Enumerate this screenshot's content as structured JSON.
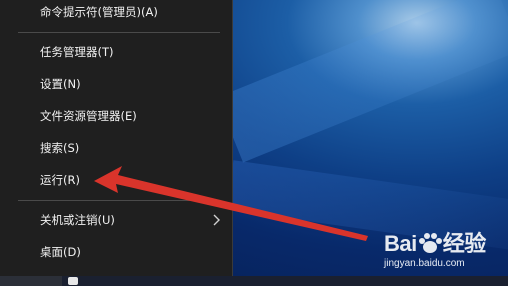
{
  "menu": {
    "items": [
      {
        "label": "命令提示符(管理员)(A)"
      },
      {
        "label": "任务管理器(T)"
      },
      {
        "label": "设置(N)"
      },
      {
        "label": "文件资源管理器(E)"
      },
      {
        "label": "搜索(S)"
      },
      {
        "label": "运行(R)"
      },
      {
        "label": "关机或注销(U)"
      },
      {
        "label": "桌面(D)"
      }
    ]
  },
  "watermark": {
    "brand_pre": "Bai",
    "brand_post": "经验",
    "url": "jingyan.baidu.com"
  },
  "colors": {
    "menu_bg": "#1f1f1f",
    "arrow": "#d9342b",
    "text": "#f2f2f2"
  },
  "icons": [
    "chevron-right-icon",
    "paw-icon",
    "arrow-pointer"
  ]
}
